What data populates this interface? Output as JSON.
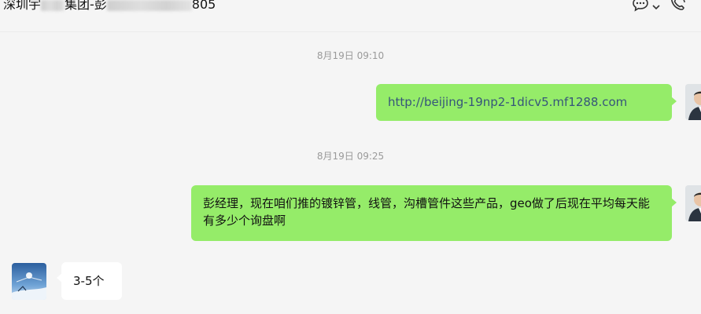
{
  "header": {
    "title_part1": "深圳宇",
    "title_part2": "集团-彭",
    "title_part3": "805",
    "icons": [
      "chat-icon",
      "chevron-down-icon",
      "phone-icon"
    ]
  },
  "messages": [
    {
      "type": "timestamp",
      "text": "8月19日 09:10"
    },
    {
      "type": "sent",
      "text": "http://beijing-19np2-1dicv5.mf1288.com"
    },
    {
      "type": "timestamp",
      "text": "8月19日 09:25"
    },
    {
      "type": "sent",
      "text": "彭经理，现在咱们推的镀锌管，线管，沟槽管件这些产品，geo做了后现在平均每天能有多少个询盘啊"
    },
    {
      "type": "received",
      "text": "3-5个"
    }
  ]
}
